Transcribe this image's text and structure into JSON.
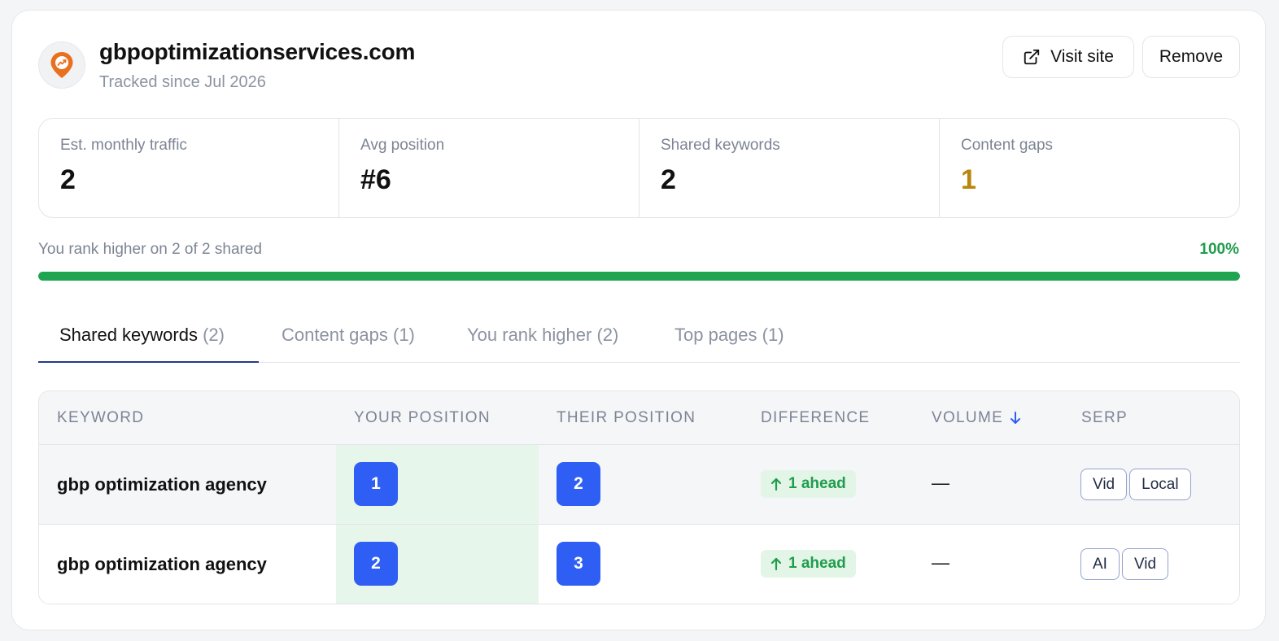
{
  "site": {
    "domain": "gbpoptimizationservices.com",
    "tracked": "Tracked since Jul 2026",
    "logo_icon": "map-pin-trend-icon",
    "accent": "#e8701f"
  },
  "actions": {
    "visit_label": "Visit site",
    "visit_icon": "external-link-icon",
    "remove_label": "Remove"
  },
  "stats": [
    {
      "label": "Est. monthly traffic",
      "value": "2"
    },
    {
      "label": "Avg position",
      "value": "#6"
    },
    {
      "label": "Shared keywords",
      "value": "2"
    },
    {
      "label": "Content gaps",
      "value": "1"
    }
  ],
  "rank": {
    "text": "You rank higher on 2 of 2 shared",
    "percent_label": "100%",
    "progress_fraction": 1.0,
    "color": "#1fa450"
  },
  "tabs": [
    {
      "label": "Shared keywords",
      "count": "(2)",
      "active": true
    },
    {
      "label": "Content gaps",
      "count": "(1)"
    },
    {
      "label": "You rank higher",
      "count": "(2)"
    },
    {
      "label": "Top pages",
      "count": "(1)"
    }
  ],
  "table": {
    "columns": [
      "KEYWORD",
      "YOUR POSITION",
      "THEIR POSITION",
      "DIFFERENCE",
      "VOLUME",
      "SERP"
    ],
    "sort_icon": "arrow-down-icon",
    "rows": [
      {
        "keyword": "gbp optimization agency",
        "your_position": "1",
        "their_position": "2",
        "difference": "1 ahead",
        "volume": "—",
        "serp": [
          "Vid",
          "Local"
        ]
      },
      {
        "keyword": "gbp optimization agency",
        "your_position": "2",
        "their_position": "3",
        "difference": "1 ahead",
        "volume": "—",
        "serp": [
          "AI",
          "Vid"
        ]
      }
    ]
  }
}
